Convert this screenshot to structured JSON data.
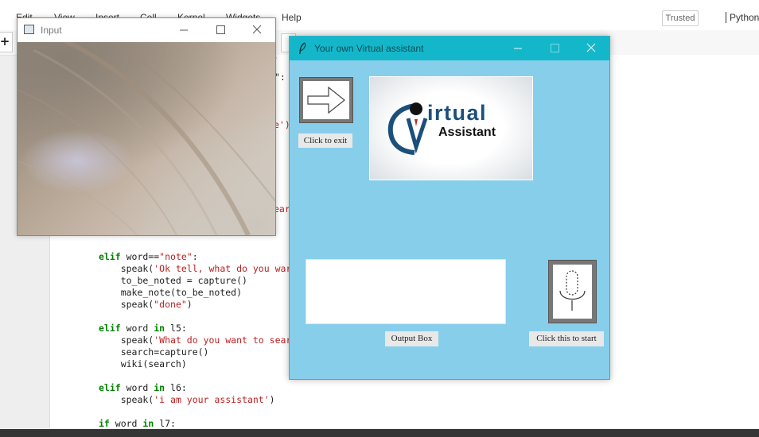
{
  "jupyter": {
    "menu": [
      "Edit",
      "View",
      "Insert",
      "Cell",
      "Kernel",
      "Widgets",
      "Help"
    ],
    "trusted": "Trusted",
    "kernel": "Python",
    "add_cell": "+"
  },
  "code": {
    "peek": [
      ",",
      "\":",
      "e')",
      "ear",
      "\")"
    ],
    "lines": [
      {
        "kw": "elif",
        "rest_a": " word==",
        "str": "\"note\"",
        "rest_b": ":"
      },
      {
        "rest_a": "    speak(",
        "str": "'Ok tell, what do you war",
        "rest_b": ""
      },
      {
        "rest_a": "    to_be_noted = capture()",
        "str": "",
        "rest_b": ""
      },
      {
        "rest_a": "    make_note(to_be_noted)",
        "str": "",
        "rest_b": ""
      },
      {
        "rest_a": "    speak(",
        "str": "\"done\"",
        "rest_b": ")"
      },
      {
        "kw": "elif",
        "rest_a": " word ",
        "kw2": "in",
        "rest_b": " l5:"
      },
      {
        "rest_a": "    speak(",
        "str": "'What do you want to sear",
        "rest_b": ""
      },
      {
        "rest_a": "    search=capture()",
        "str": "",
        "rest_b": ""
      },
      {
        "rest_a": "    wiki(search)",
        "str": "",
        "rest_b": ""
      },
      {
        "kw": "elif",
        "rest_a": " word ",
        "kw2": "in",
        "rest_b": " l6:"
      },
      {
        "rest_a": "    speak(",
        "str": "'i am your assistant'",
        "rest_b": ")"
      },
      {
        "kw": "if",
        "rest_a": " word ",
        "kw2": "in",
        "rest_b": " l7:"
      }
    ]
  },
  "input_window": {
    "title": "Input"
  },
  "assistant_window": {
    "title": "Your own Virtual assistant",
    "exit_label": "Click to exit",
    "logo_virtual": "irtual",
    "logo_assistant": "Assistant",
    "output_label": "Output Box",
    "start_label": "Click this to start"
  },
  "icons": {
    "exit_button": "arrow-right-icon",
    "start_button": "microphone-icon",
    "title_icon": "feather-icon"
  },
  "colors": {
    "assistant_bg": "#87ceeb",
    "assistant_titlebar": "#14b7c9",
    "logo_blue": "#1b4f7c",
    "code_keyword": "#008000",
    "code_string": "#ba2121"
  }
}
